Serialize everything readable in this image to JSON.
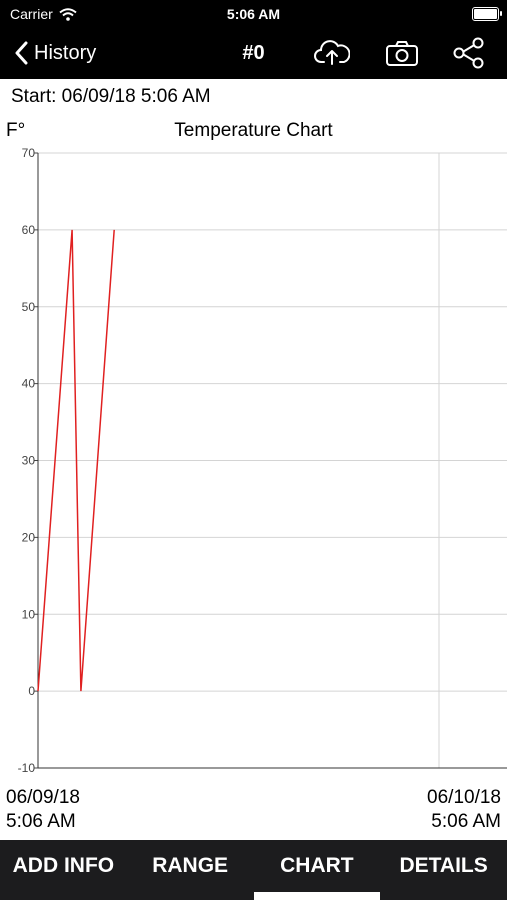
{
  "status_bar": {
    "carrier": "Carrier",
    "time": "5:06 AM"
  },
  "nav": {
    "back_label": "History",
    "title": "#0"
  },
  "header": {
    "start_label": "Start: 06/09/18 5:06 AM",
    "unit": "F°"
  },
  "x_labels": {
    "left_date": "06/09/18",
    "left_time": "5:06 AM",
    "right_date": "06/10/18",
    "right_time": "5:06 AM"
  },
  "chart_data": {
    "type": "line",
    "title": "Temperature Chart",
    "ylabel": "F°",
    "ylim": [
      -10,
      70
    ],
    "yticks": [
      "-10",
      "0",
      "10",
      "20",
      "30",
      "40",
      "50",
      "60",
      "70"
    ],
    "grid": true,
    "series": [
      {
        "color": "#e02020",
        "x": [
          0,
          0.085,
          0.107,
          0.19
        ],
        "y": [
          0,
          60,
          0,
          60
        ]
      }
    ]
  },
  "tabs": [
    {
      "label": "ADD INFO",
      "active": false
    },
    {
      "label": "RANGE",
      "active": false
    },
    {
      "label": "CHART",
      "active": true
    },
    {
      "label": "DETAILS",
      "active": false
    }
  ],
  "colors": {
    "bar_background": "#000000",
    "tab_background": "#1c1c1e",
    "series": "#e02020"
  }
}
